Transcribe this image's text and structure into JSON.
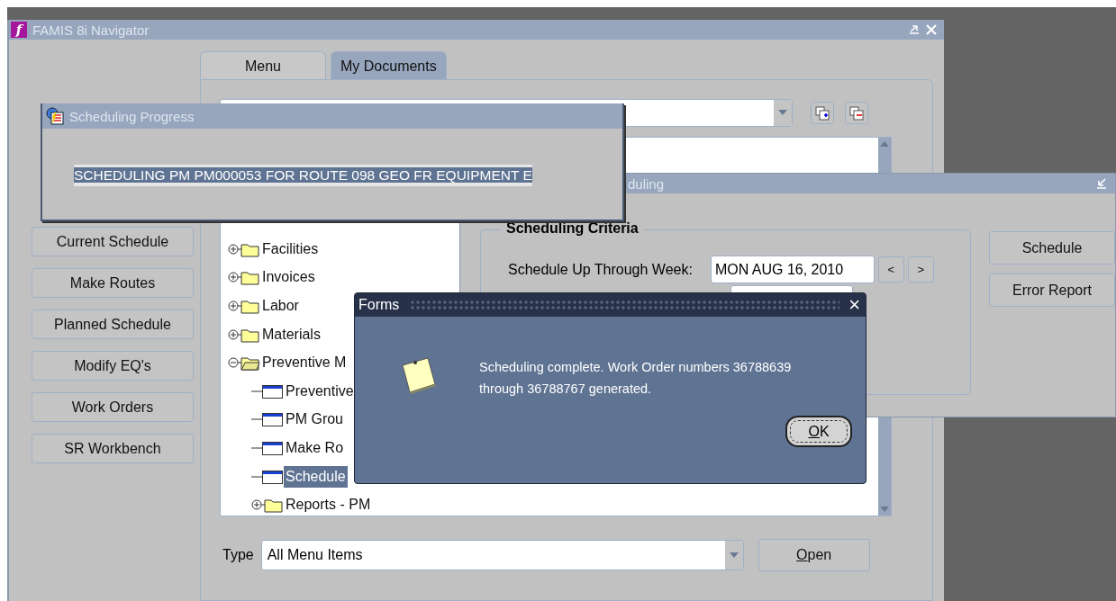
{
  "navigator": {
    "title": "FAMIS 8i Navigator",
    "logo": "f",
    "tabs": [
      {
        "label": "Menu",
        "selected": true
      },
      {
        "label": "My Documents",
        "selected": false
      }
    ],
    "side_buttons": [
      "Current Schedule",
      "Make Routes",
      "Planned Schedule",
      "Modify EQ's",
      "Work Orders",
      "SR Workbench"
    ],
    "tree": [
      {
        "label": "Facilities",
        "kind": "folder",
        "expanded": false,
        "selected": false
      },
      {
        "label": "Invoices",
        "kind": "folder",
        "expanded": false,
        "selected": false
      },
      {
        "label": "Labor",
        "kind": "folder",
        "expanded": false,
        "selected": false
      },
      {
        "label": "Materials",
        "kind": "folder",
        "expanded": false,
        "selected": false
      },
      {
        "label": "Preventive M",
        "kind": "folder",
        "expanded": true,
        "selected": false,
        "children": [
          {
            "label": "Preventive",
            "kind": "form",
            "selected": false
          },
          {
            "label": "PM Grou",
            "kind": "form",
            "selected": false
          },
          {
            "label": "Make Ro",
            "kind": "form",
            "selected": false
          },
          {
            "label": "Schedule",
            "kind": "form",
            "selected": true
          },
          {
            "label": "Reports - PM",
            "kind": "folder",
            "expanded": false,
            "selected": false
          }
        ]
      }
    ],
    "type_label": "Type",
    "type_value": "All Menu Items",
    "open_button": "Open"
  },
  "scheduling_window": {
    "title": "duling",
    "group_title": "Scheduling Criteria",
    "week_label": "Schedule Up Through Week:",
    "week_value": "MON AUG 16, 2010",
    "prev": "<",
    "next": ">",
    "buttons": [
      "Schedule",
      "Error Report"
    ]
  },
  "progress_window": {
    "title": "Scheduling Progress",
    "message": "SCHEDULING PM PM000053 FOR ROUTE 098 GEO FR EQUIPMENT E"
  },
  "alert": {
    "title": "Forms",
    "close": "×",
    "message": "Scheduling complete. Work Order numbers 36788639 through 36788767 generated.",
    "ok": "OK"
  }
}
